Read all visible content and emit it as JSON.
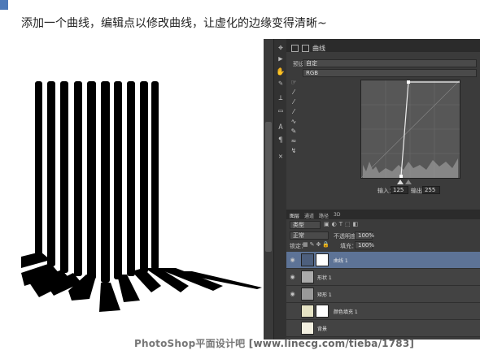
{
  "caption": "添加一个曲线，编辑点以修改曲线，让虚化的边缘变得清晰~",
  "properties": {
    "title": "曲线",
    "preset_label": "预设：",
    "preset_value": "自定",
    "channel_value": "RGB"
  },
  "curves": {
    "input_label": "输入：",
    "input_value": "125",
    "output_label": "输出：",
    "output_value": "255"
  },
  "layers": {
    "tabs": [
      "图层",
      "通道",
      "路径",
      "3D"
    ],
    "kind_label": "类型",
    "blend_mode": "正常",
    "opacity_label": "不透明度：",
    "opacity_value": "100%",
    "lock_label": "锁定：",
    "fill_label": "填充：",
    "fill_value": "100%",
    "rows": [
      {
        "name": "曲线 1"
      },
      {
        "name": "形状 1"
      },
      {
        "name": "矩形 1"
      },
      {
        "name": "颜色填充 1"
      },
      {
        "name": "背景"
      }
    ]
  },
  "tool_icons": [
    "move-icon",
    "hand-icon",
    "brush-icon",
    "stamp-icon",
    "eraser-icon",
    "text-icon",
    "pen-icon",
    "zoom-icon"
  ],
  "watermark": {
    "brand": "PhotoShop平面设计吧",
    "url": "[www.linecg.com/tieba/1783]"
  },
  "colors": {
    "panel_bg": "#3b3b3b",
    "selected_layer": "#5d7396",
    "stripe": "#000000"
  }
}
